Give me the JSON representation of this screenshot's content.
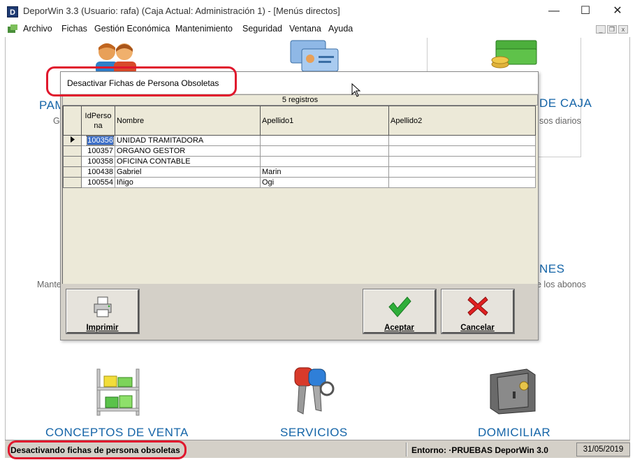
{
  "window": {
    "title": "DeporWin 3.3  (Usuario: rafa)  (Caja Actual: Administración 1) - [Menús directos]",
    "app_icon_letter": "D",
    "minimize_glyph": "—",
    "maximize_glyph": "☐",
    "close_glyph": "✕"
  },
  "menu": {
    "items": [
      "Archivo",
      "Fichas",
      "Gestión Económica",
      "Mantenimiento",
      "Seguridad",
      "Ventana",
      "Ayuda"
    ],
    "mdi_minimize": "_",
    "mdi_restore": "❐",
    "mdi_close": "x"
  },
  "tiles": {
    "partial_left_title": "PAM",
    "partial_left_sub": "G",
    "caja_title": "DE CAJA",
    "caja_sub": "sos diarios",
    "abonos_title": "NES",
    "abonos_sub_left": "Mante",
    "abonos_sub_right": "e los abonos",
    "conceptos_title": "CONCEPTOS DE VENTA",
    "servicios_title": "SERVICIOS",
    "domiciliar_title": "DOMICILIAR"
  },
  "dialog": {
    "title": "Desactivar Fichas de Persona Obsoletas",
    "count": "5 registros",
    "columns": [
      "IdPersona",
      "Nombre",
      "Apellido1",
      "Apellido2"
    ],
    "rows": [
      {
        "id": "100356",
        "nombre": "UNIDAD TRAMITADORA",
        "apellido1": "",
        "apellido2": ""
      },
      {
        "id": "100357",
        "nombre": "ORGANO GESTOR",
        "apellido1": "",
        "apellido2": ""
      },
      {
        "id": "100358",
        "nombre": "OFICINA CONTABLE",
        "apellido1": "",
        "apellido2": ""
      },
      {
        "id": "100438",
        "nombre": "Gabriel",
        "apellido1": "Marin",
        "apellido2": ""
      },
      {
        "id": "100554",
        "nombre": "Iñigo",
        "apellido1": "Ogi",
        "apellido2": ""
      }
    ],
    "buttons": {
      "print": "Imprimir",
      "accept": "Aceptar",
      "cancel": "Cancelar"
    }
  },
  "status": {
    "message": "Desactivando fichas de persona obsoletas",
    "environment": "Entorno: ·PRUEBAS DeporWin 3.0",
    "date": "31/05/2019"
  },
  "colors": {
    "accent_blue": "#1565a8",
    "annotation_red": "#e0182d",
    "selection": "#3d6fc8"
  }
}
